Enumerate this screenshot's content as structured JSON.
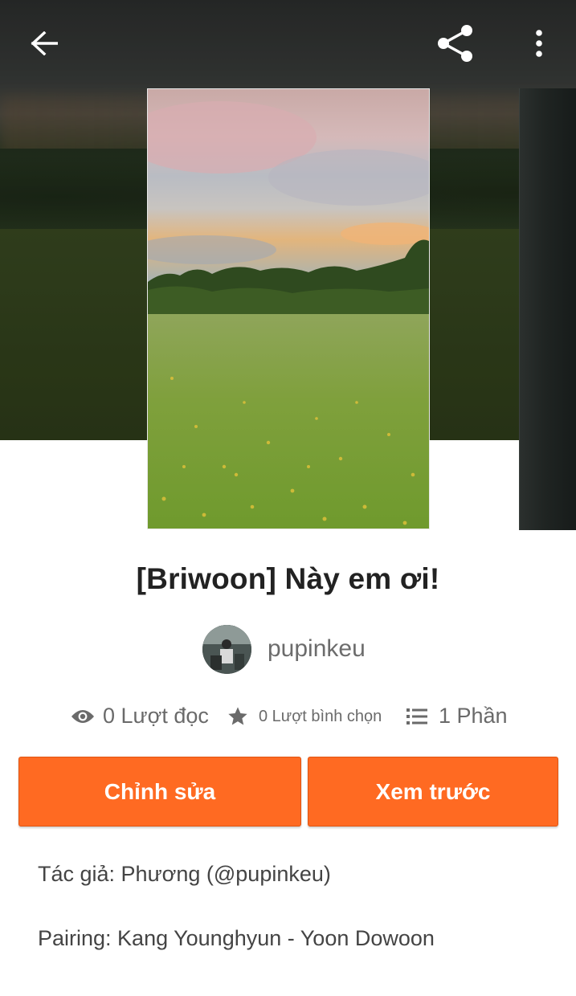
{
  "header": {
    "back_icon": "arrow-left-icon",
    "share_icon": "share-icon",
    "more_icon": "more-vertical-icon"
  },
  "story": {
    "title": "[Briwoon] Này em ơi!",
    "author": "pupinkeu",
    "stats": {
      "reads": "0 Lượt đọc",
      "votes": "0 Lượt bình chọn",
      "parts": "1 Phần"
    }
  },
  "actions": {
    "edit_label": "Chỉnh sửa",
    "preview_label": "Xem trước"
  },
  "description": {
    "line1": "Tác giả: Phương (@pupinkeu)",
    "line2": "Pairing: Kang Younghyun - Yoon Dowoon"
  },
  "colors": {
    "accent": "#ff6a22",
    "text_primary": "#222222",
    "text_secondary": "#6a6a6a"
  }
}
